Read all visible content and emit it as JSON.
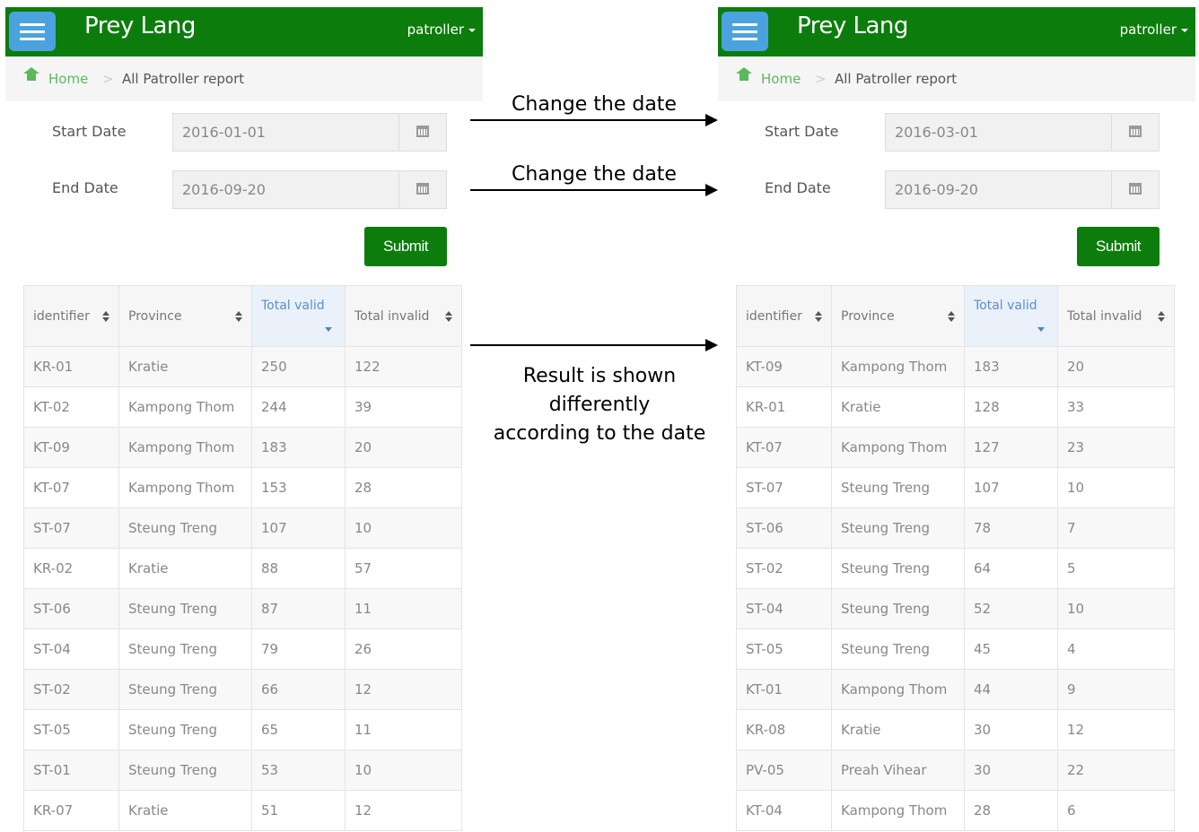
{
  "app": {
    "brand": "Prey Lang",
    "user_menu": "patroller"
  },
  "breadcrumb": {
    "home": "Home",
    "separator": ">",
    "current": "All Patroller report"
  },
  "form": {
    "start_label": "Start Date",
    "end_label": "End Date",
    "submit_label": "Submit"
  },
  "columns": [
    "identifier",
    "Province",
    "Total valid",
    "Total invalid"
  ],
  "left": {
    "start_date": "2016-01-01",
    "end_date": "2016-09-20",
    "rows": [
      [
        "KR-01",
        "Kratie",
        "250",
        "122"
      ],
      [
        "KT-02",
        "Kampong Thom",
        "244",
        "39"
      ],
      [
        "KT-09",
        "Kampong Thom",
        "183",
        "20"
      ],
      [
        "KT-07",
        "Kampong Thom",
        "153",
        "28"
      ],
      [
        "ST-07",
        "Steung Treng",
        "107",
        "10"
      ],
      [
        "KR-02",
        "Kratie",
        "88",
        "57"
      ],
      [
        "ST-06",
        "Steung Treng",
        "87",
        "11"
      ],
      [
        "ST-04",
        "Steung Treng",
        "79",
        "26"
      ],
      [
        "ST-02",
        "Steung Treng",
        "66",
        "12"
      ],
      [
        "ST-05",
        "Steung Treng",
        "65",
        "11"
      ],
      [
        "ST-01",
        "Steung Treng",
        "53",
        "10"
      ],
      [
        "KR-07",
        "Kratie",
        "51",
        "12"
      ]
    ]
  },
  "right": {
    "start_date": "2016-03-01",
    "end_date": "2016-09-20",
    "rows": [
      [
        "KT-09",
        "Kampong Thom",
        "183",
        "20"
      ],
      [
        "KR-01",
        "Kratie",
        "128",
        "33"
      ],
      [
        "KT-07",
        "Kampong Thom",
        "127",
        "23"
      ],
      [
        "ST-07",
        "Steung Treng",
        "107",
        "10"
      ],
      [
        "ST-06",
        "Steung Treng",
        "78",
        "7"
      ],
      [
        "ST-02",
        "Steung Treng",
        "64",
        "5"
      ],
      [
        "ST-04",
        "Steung Treng",
        "52",
        "10"
      ],
      [
        "ST-05",
        "Steung Treng",
        "45",
        "4"
      ],
      [
        "KT-01",
        "Kampong Thom",
        "44",
        "9"
      ],
      [
        "KR-08",
        "Kratie",
        "30",
        "12"
      ],
      [
        "PV-05",
        "Preah Vihear",
        "30",
        "22"
      ],
      [
        "KT-04",
        "Kampong Thom",
        "28",
        "6"
      ]
    ]
  },
  "annotations": {
    "change_start": "Change the date",
    "change_end": "Change the date",
    "result_line1": "Result is shown",
    "result_line2": "differently",
    "result_line3": "according to the date"
  }
}
